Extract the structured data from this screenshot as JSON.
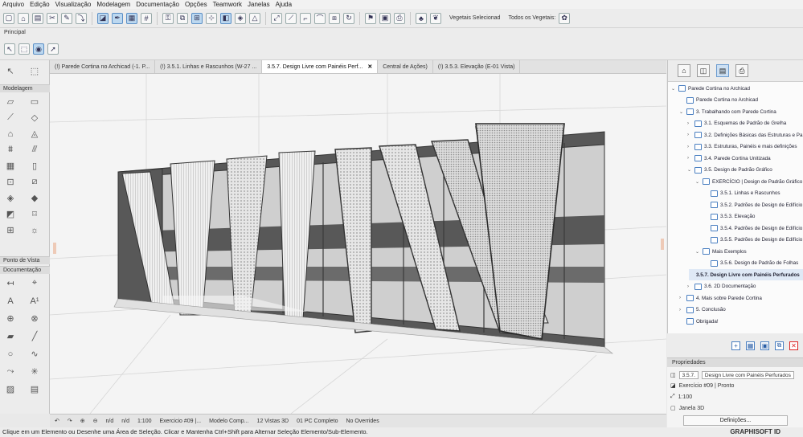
{
  "menu": [
    "Arquivo",
    "Edição",
    "Visualização",
    "Modelagem",
    "Documentação",
    "Opções",
    "Teamwork",
    "Janelas",
    "Ajuda"
  ],
  "toolbar": {
    "vegetais_selecionados": "Vegetais Selecionad",
    "todos_vegetais": "Todos os Vegetais:",
    "principal": "Principal"
  },
  "tabs": [
    {
      "label": "(!) Parede Cortina no Archicad (-1. P...",
      "active": false
    },
    {
      "label": "(!) 3.5.1. Linhas e Rascunhos (W-27 ...",
      "active": false
    },
    {
      "label": "3.5.7. Design Livre com Painéis Perf...",
      "active": true
    },
    {
      "label": "Central de Ações)",
      "active": false
    },
    {
      "label": "(!) 3.5.3. Elevação (E-01 Vista)",
      "active": false
    }
  ],
  "toolbox": {
    "selection_header": "",
    "modelagem": "Modelagem",
    "ponto_de_vista": "Ponto de Vista",
    "documentacao": "Documentação"
  },
  "statusbar": {
    "zoom_na_1": "n/d",
    "zoom_na_2": "n/d",
    "scale": "1:100",
    "exercise": "Exercicio #09 |...",
    "model": "Modelo Comp...",
    "views3d": "12 Vistas 3D",
    "pc": "01 PC Completo",
    "overrides": "No Overrides"
  },
  "hint": "Clique em um Elemento ou Desenhe uma Área de Seleção. Clicar e Mantenha Ctrl+Shift para Alternar Seleção Elemento/Sub-Elemento.",
  "brand": "GRAPHISOFT ID",
  "navigator": {
    "items": [
      {
        "label": "Parede Cortina no Archicad",
        "depth": 0,
        "arrow": "⌄"
      },
      {
        "label": "Parede Cortina no Archicad",
        "depth": 1,
        "arrow": ""
      },
      {
        "label": "3. Trabalhando com Parede Cortina",
        "depth": 1,
        "arrow": "⌄"
      },
      {
        "label": "3.1. Esquemas de Padrão de Grelha",
        "depth": 2,
        "arrow": "›"
      },
      {
        "label": "3.2. Definições Básicas das Estruturas e Pa",
        "depth": 2,
        "arrow": "›"
      },
      {
        "label": "3.3. Estruturas, Painéis e mais definições",
        "depth": 2,
        "arrow": "›"
      },
      {
        "label": "3.4. Parede Cortina Unitizada",
        "depth": 2,
        "arrow": "›"
      },
      {
        "label": "3.5. Design de Padrão Gráfico",
        "depth": 2,
        "arrow": "⌄"
      },
      {
        "label": "EXERCÍCIO | Design de Padrão Gráfico",
        "depth": 3,
        "arrow": "⌄"
      },
      {
        "label": "3.5.1. Linhas e Rascunhos",
        "depth": 4,
        "arrow": ""
      },
      {
        "label": "3.5.2. Padrões de Design de Edifício",
        "depth": 4,
        "arrow": ""
      },
      {
        "label": "3.5.3. Elevação",
        "depth": 4,
        "arrow": ""
      },
      {
        "label": "3.5.4. Padrões de Design de Edifício",
        "depth": 4,
        "arrow": ""
      },
      {
        "label": "3.5.5. Padrões de Design de Edifício |",
        "depth": 4,
        "arrow": ""
      },
      {
        "label": "Mais Exemplos",
        "depth": 3,
        "arrow": "⌄"
      },
      {
        "label": "3.5.6. Design de Padrão de Folhas",
        "depth": 4,
        "arrow": ""
      },
      {
        "label": "3.5.7. Design Livre com Painéis Perfurados",
        "depth": 3,
        "arrow": "",
        "selected": true
      },
      {
        "label": "3.6. 2D Documentação",
        "depth": 2,
        "arrow": "›"
      },
      {
        "label": "4. Mais sobre Parede Cortina",
        "depth": 1,
        "arrow": "›"
      },
      {
        "label": "5. Conclusão",
        "depth": 1,
        "arrow": "›"
      },
      {
        "label": "Obrigada!",
        "depth": 1,
        "arrow": ""
      }
    ]
  },
  "properties": {
    "header": "Propriedades",
    "id": "3.5.7.",
    "name": "Design Livre com Painéis Perfurados",
    "exercise": "Exercício #09 | Pronto",
    "scale": "1:100",
    "window": "Janela 3D",
    "defs_button": "Definições..."
  },
  "colors": {
    "panel_dark": "#585858",
    "perforated": "#d8d8d8",
    "frame": "#333333",
    "selected": "#dfe9f6"
  }
}
